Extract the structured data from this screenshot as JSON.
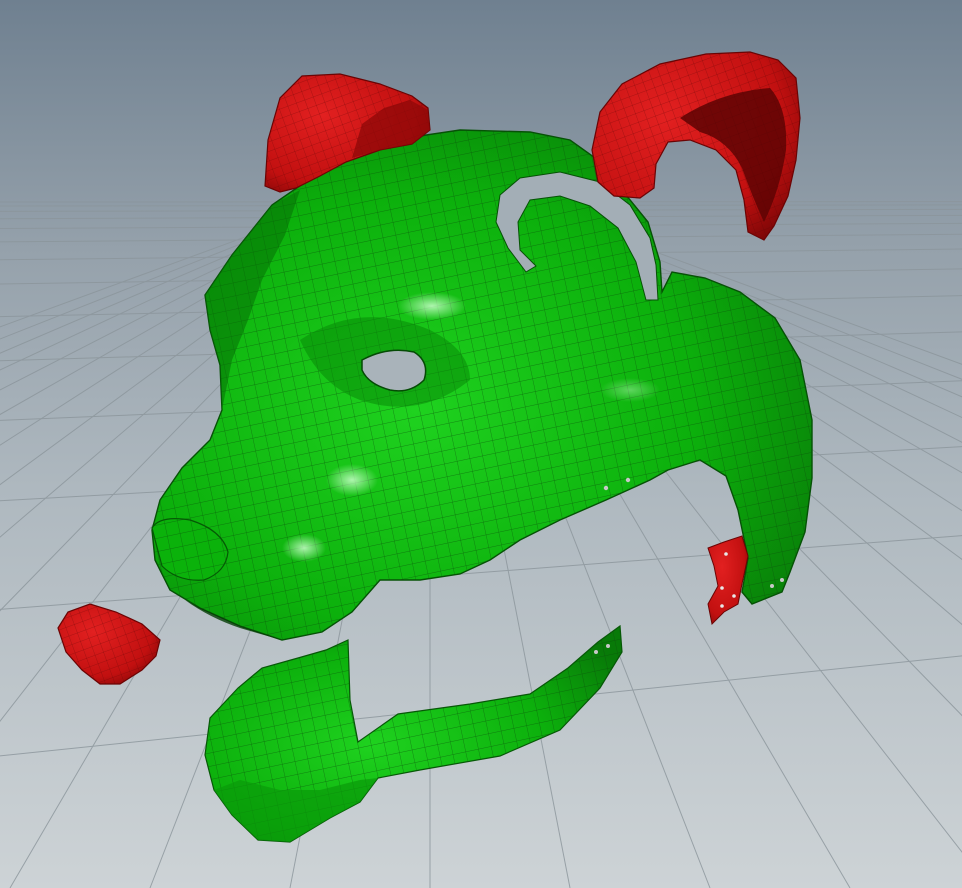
{
  "viewport": {
    "background_top": "#6f8090",
    "background_mid": "#a9b4bc",
    "background_bottom": "#c9cfd3",
    "grid_color": "#8d969c"
  },
  "model": {
    "parts": [
      {
        "name": "head-shell",
        "color": "#0db30d",
        "wireframe": "#0a4f0a"
      },
      {
        "name": "lower-jaw",
        "color": "#0db30d",
        "wireframe": "#0a4f0a"
      },
      {
        "name": "left-ear",
        "color": "#c81414"
      },
      {
        "name": "right-ear",
        "color": "#c81414"
      },
      {
        "name": "nose",
        "color": "#c81414"
      },
      {
        "name": "hinge-clip",
        "color": "#c81414"
      }
    ]
  }
}
